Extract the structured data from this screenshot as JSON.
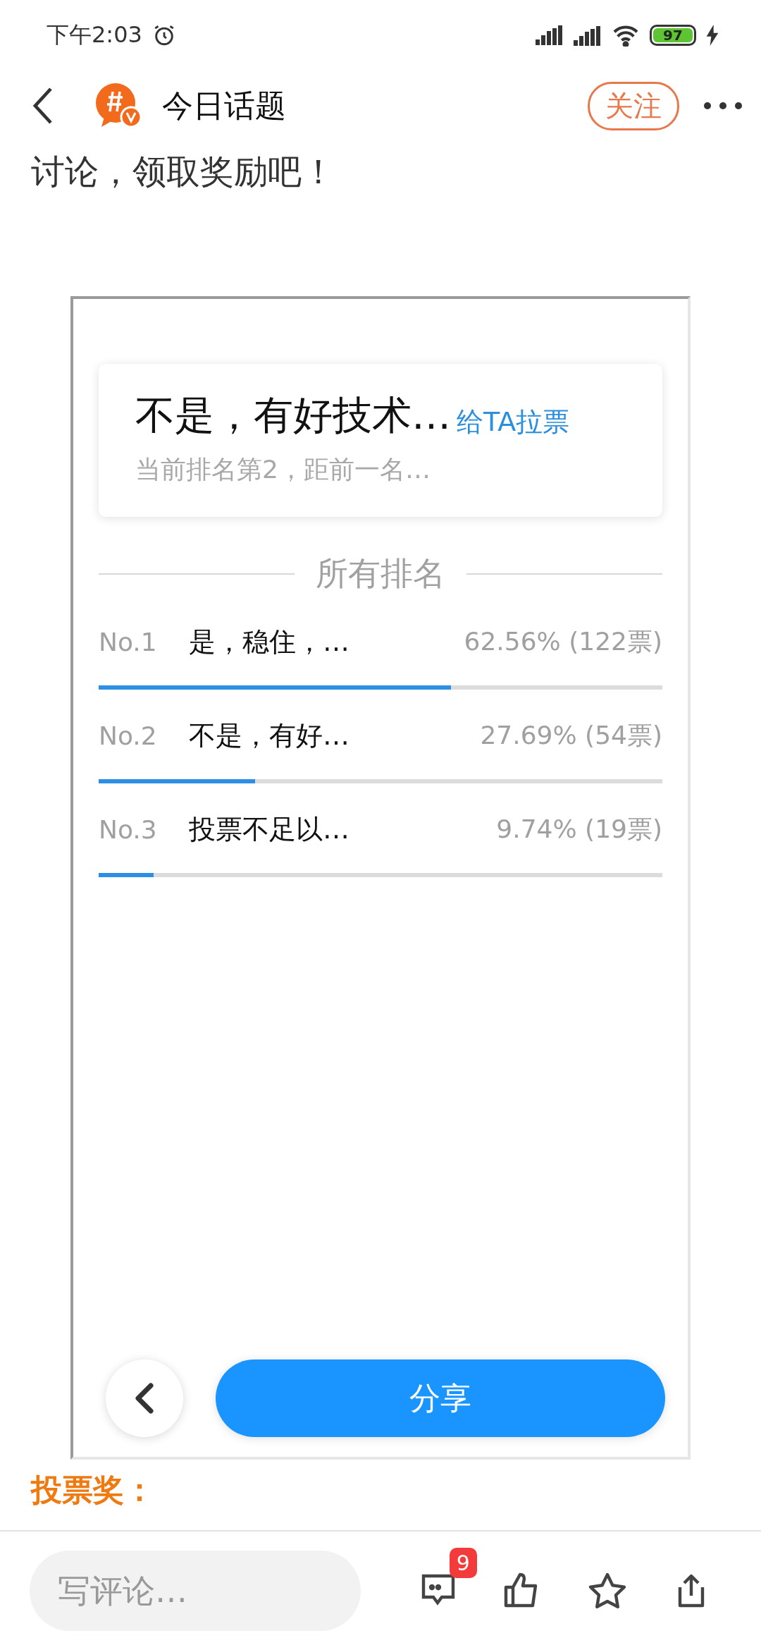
{
  "status_bar": {
    "time": "下午2:03",
    "battery": "97"
  },
  "header": {
    "title": "今日话题",
    "follow_button": "关注"
  },
  "intro": "讨论，领取奖励吧！",
  "poll": {
    "current": {
      "title": "不是，有好技术…",
      "vote_link": "给TA拉票",
      "detail": "当前排名第2，距前一名…"
    },
    "section_title": "所有排名",
    "rankings": [
      {
        "rank": "No.1",
        "option": "是，稳住，…",
        "result": "62.56% (122票)",
        "level": 0.6256
      },
      {
        "rank": "No.2",
        "option": "不是，有好…",
        "result": "27.69% (54票)",
        "level": 0.2769
      },
      {
        "rank": "No.3",
        "option": "投票不足以…",
        "result": "9.74% (19票)",
        "level": 0.0974
      }
    ],
    "share_button": "分享"
  },
  "next_heading": "投票奖：",
  "bottom_bar": {
    "comment_placeholder": "写评论…",
    "comment_count": "9"
  }
}
